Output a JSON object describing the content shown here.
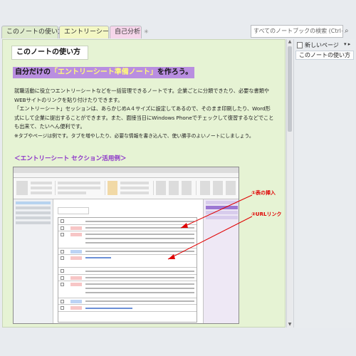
{
  "tabs": [
    {
      "label": "このノートの使い方"
    },
    {
      "label": "エントリーシート"
    },
    {
      "label": "自己分析"
    }
  ],
  "search": {
    "placeholder": "すべてのノートブックの検索 (Ctrl+E)"
  },
  "page": {
    "title": "このノートの使い方",
    "heading_prefix": "自分だけの",
    "heading_highlight": "「エントリーシート準備ノート」",
    "heading_suffix": "を作ろう。",
    "paragraphs": [
      "就職活動に役立つエントリーシートなどを一括管理できるノートです。企業ごとに分類できたり、必要な書類や",
      "WEBサイトのリンクを貼り付けたりできます。",
      "「エントリーシート」セッションは、あらかじめA４サイズに設定してあるので、そのまま印刷したり、Word形",
      "式にして企業に提出することができます。また、面接当日にWindows Phoneでチェックして復習するなどでこと",
      "も出来て、たいへん便利です。",
      "※タブやページは例です。タブを増やしたり、必要な情報を書き込んで、使い勝手のよいノートにしましょう。"
    ],
    "section_title": "＜エントリーシート セクション活用例＞",
    "callouts": {
      "insert_table": "①表の挿入",
      "url_link": "②URLリンク"
    }
  },
  "right_pane": {
    "new_page_label": "新しいページ",
    "pages": [
      "このノートの使い方"
    ]
  },
  "colors": {
    "page_bg": "#e6f3d4",
    "heading_bg": "#b98ee0",
    "section_title": "#8a2fc9",
    "callout": "#e00000"
  }
}
